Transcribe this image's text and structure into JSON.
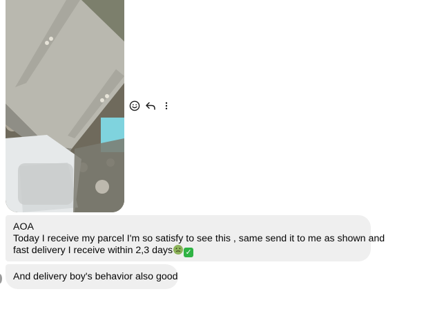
{
  "conversation": {
    "photo": {
      "alt": "grey handbag photo",
      "colors": {
        "bag": "#b9b8af",
        "bag_shadow": "#8f8e86",
        "strap": "#aeada4",
        "background_pattern": "#6f7660",
        "plastic": "#e6e9ea",
        "accent_teal": "#58c4d4"
      }
    },
    "actions": {
      "react_icon": "smiley-face-icon",
      "reply_icon": "reply-arrow-icon",
      "more_icon": "vertical-ellipsis-icon"
    },
    "messages": [
      {
        "lines": [
          "AOA",
          "Today I receive my parcel I'm so satisfy to see this , same send it to me as shown and",
          "fast delivery I receive within 2,3 days"
        ],
        "emojis": [
          "nauseated-face-emoji",
          "check-mark-button-emoji"
        ]
      },
      {
        "lines": [
          "And delivery boy's behavior also good"
        ]
      }
    ],
    "colors": {
      "bubble_bg": "#efefef",
      "text": "#050505",
      "icon": "#1c1c1c"
    }
  }
}
